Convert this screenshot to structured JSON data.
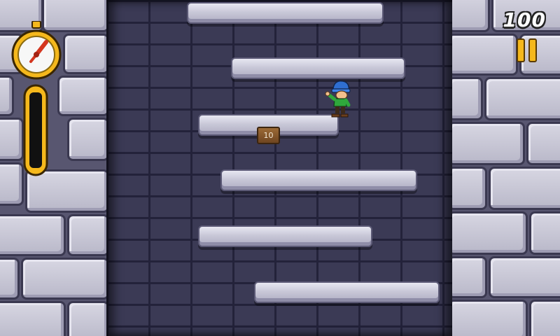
{
  "hud": {
    "score": "100",
    "combo_meter_fill": 0
  },
  "floor_sign": {
    "label": "10"
  },
  "colors": {
    "gold": "#f5b81c",
    "ice": "#c9c8d8",
    "brick": "#3b3a55"
  },
  "icons": {
    "timer": "stopwatch-icon",
    "pause": "pause-icon"
  }
}
